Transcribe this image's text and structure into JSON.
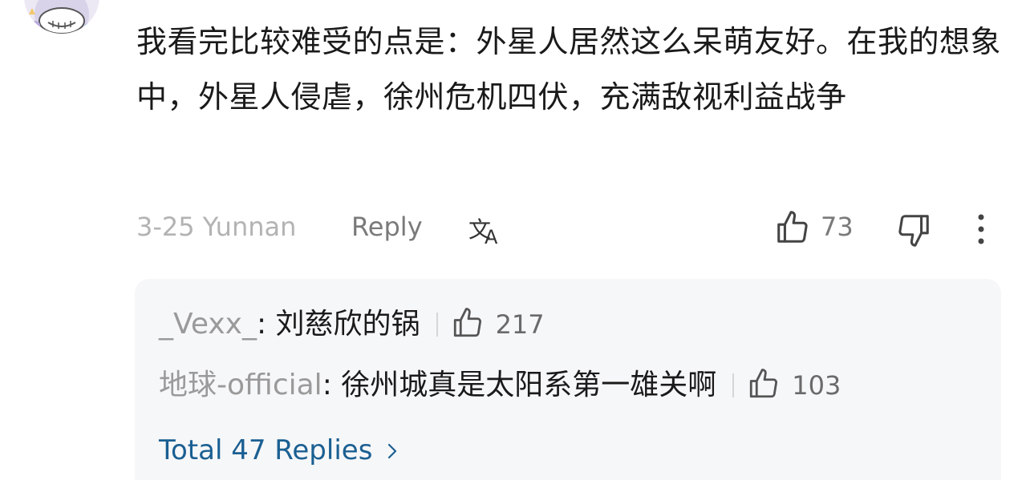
{
  "comment": {
    "text": "我看完比较难受的点是：外星人居然这么呆萌友好。在我的想象中，外星人侵虐，徐州危机四伏，充满敌视利益战争",
    "date_location": "3-25 Yunnan",
    "reply_label": "Reply",
    "like_count": "73",
    "icons": {
      "translate": "translate-icon",
      "like": "thumbs-up-icon",
      "dislike": "thumbs-down-icon",
      "more": "more-vertical-icon",
      "avatar": "avatar"
    }
  },
  "replies": [
    {
      "author": "_Vexx_",
      "separator": ": ",
      "text": "刘慈欣的锅",
      "likes": "217"
    },
    {
      "author": "地球-official",
      "separator": ": ",
      "text": "徐州城真是太阳系第一雄关啊",
      "likes": "103"
    }
  ],
  "total_replies_label": "Total 47 Replies",
  "colors": {
    "text": "#1a1a1a",
    "muted": "#9a9a9a",
    "link": "#1a5f92",
    "panel": "#f6f7f9"
  }
}
